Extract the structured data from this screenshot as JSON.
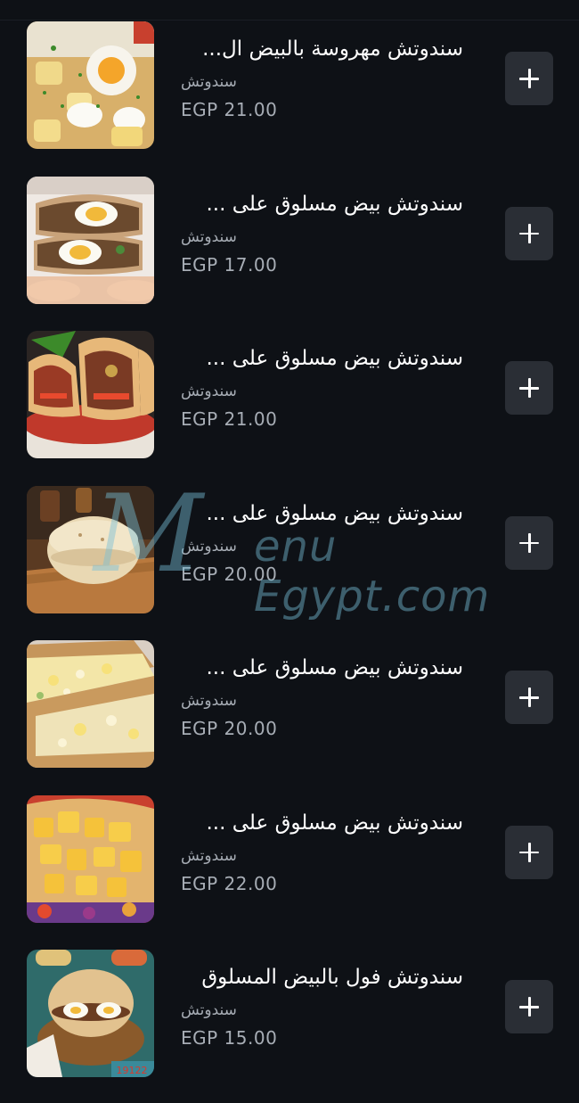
{
  "items": [
    {
      "name": "سندوتش مهروسة بالبيض ال...",
      "category": "سندوتش",
      "price": "EGP 21.00",
      "image": "mashed-egg-potato"
    },
    {
      "name": "سندوتش بيض مسلوق على ...",
      "category": "سندوتش",
      "price": "EGP 17.00",
      "image": "egg-wrap"
    },
    {
      "name": "سندوتش بيض مسلوق على ...",
      "category": "سندوتش",
      "price": "EGP 21.00",
      "image": "pita-with-vegetables"
    },
    {
      "name": "سندوتش بيض مسلوق على ...",
      "category": "سندوتش",
      "price": "EGP 20.00",
      "image": "round-bread-sandwich"
    },
    {
      "name": "سندوتش بيض مسلوق على ...",
      "category": "سندوتش",
      "price": "EGP 20.00",
      "image": "toasted-egg-sandwich"
    },
    {
      "name": "سندوتش بيض مسلوق على ...",
      "category": "سندوتش",
      "price": "EGP 22.00",
      "image": "fries-pita"
    },
    {
      "name": "سندوتش فول بالبيض المسلوق",
      "category": "سندوتش",
      "price": "EGP 15.00",
      "image": "foul-egg-sandwich"
    }
  ],
  "watermark": {
    "letter": "M",
    "text": "enu Egypt.com"
  },
  "colors": {
    "background": "#0e1116",
    "button": "#2a2e35",
    "muted": "#a7adb5"
  }
}
